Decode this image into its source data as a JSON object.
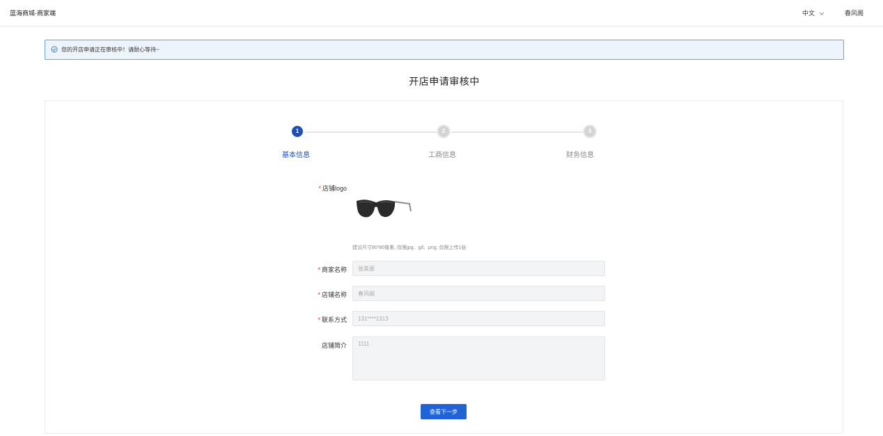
{
  "header": {
    "brand": "蓝海商城-商家端",
    "language": "中文",
    "username": "春风阁"
  },
  "alert": {
    "message": "您的开店申请正在审核中！请耐心等待~"
  },
  "page_title": "开店申请审核中",
  "steps": [
    {
      "number": "1",
      "label": "基本信息",
      "state": "active"
    },
    {
      "number": "2",
      "label": "工商信息",
      "state": "pending"
    },
    {
      "number": "3",
      "label": "财务信息",
      "state": "pending"
    }
  ],
  "form": {
    "logo": {
      "label": "店铺logo",
      "required": true,
      "image": "sunglasses-logo",
      "hint": "建议尺寸80*80像素, 仅限jpg、gif、png, 仅限上传1张"
    },
    "merchant_name": {
      "label": "商家名称",
      "required": true,
      "value": "张美丽"
    },
    "shop_name": {
      "label": "店铺名称",
      "required": true,
      "value": "春风阁"
    },
    "contact": {
      "label": "联系方式",
      "required": true,
      "value": "131****1313"
    },
    "intro": {
      "label": "店铺简介",
      "required": false,
      "value": "1111"
    }
  },
  "next_button": "查看下一步",
  "colors": {
    "primary": "#1f63d6",
    "step_active": "#1f4fb5",
    "alert_bg": "#eef4fb",
    "alert_border": "#6aa0d8",
    "required": "#e23"
  }
}
